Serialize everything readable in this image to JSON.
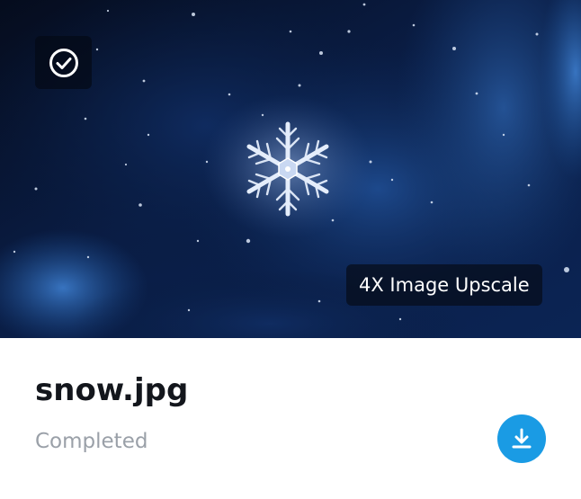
{
  "card": {
    "file_name": "snow.jpg",
    "status": "Completed",
    "tag_label": "4X Image Upscale",
    "icons": {
      "select": "check-circle-icon",
      "download": "download-icon"
    },
    "colors": {
      "accent": "#1a9be4",
      "title": "#13161c",
      "status": "#9aa0a8"
    }
  }
}
